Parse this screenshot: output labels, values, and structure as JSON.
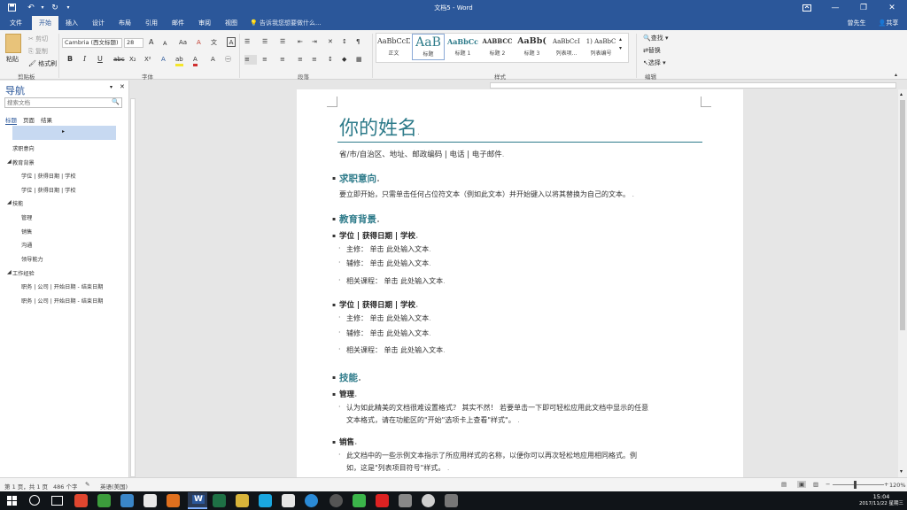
{
  "window": {
    "title": "文档5 - Word",
    "user": "曾先生",
    "share": "共享"
  },
  "tabs": [
    "文件",
    "开始",
    "插入",
    "设计",
    "布局",
    "引用",
    "邮件",
    "审阅",
    "视图"
  ],
  "tell_me": "告诉我您想要做什么...",
  "ribbon": {
    "clipboard": {
      "paste": "粘贴",
      "cut": "剪切",
      "copy": "复制",
      "format_painter": "格式刷",
      "label": "剪贴板"
    },
    "font": {
      "name": "Cambria (西文标题)",
      "size": "28",
      "label": "字体",
      "bold": "B",
      "italic": "I",
      "underline": "U",
      "strike": "abc",
      "sub": "X₂",
      "sup": "X²",
      "grow": "A",
      "shrink": "A",
      "case": "Aa",
      "font_color": "A",
      "highlight": "ab",
      "clear": "A"
    },
    "paragraph": {
      "label": "段落"
    },
    "styles": {
      "label": "样式",
      "items": [
        {
          "preview": "AaBbCcDc",
          "name": "正文"
        },
        {
          "preview": "AaB",
          "name": "标题"
        },
        {
          "preview": "AaBbCc",
          "name": "标题 1"
        },
        {
          "preview": "AABBCC",
          "name": "标题 2"
        },
        {
          "preview": "AaBb(",
          "name": "标题 3"
        },
        {
          "preview": "AaBbCcI",
          "name": "列表项..."
        },
        {
          "preview": "1) AaBbC",
          "name": "列表编号"
        }
      ]
    },
    "editing": {
      "find": "查找",
      "replace": "替换",
      "select": "选择",
      "label": "编辑"
    }
  },
  "nav": {
    "title": "导航",
    "search_placeholder": "搜索文档",
    "tabs": [
      "标题",
      "页面",
      "结果"
    ],
    "items": [
      {
        "text": "求职意向",
        "level": 1
      },
      {
        "text": "教育背景",
        "level": 1
      },
      {
        "text": "学位 | 获得日期 | 学校",
        "level": 2
      },
      {
        "text": "学位 | 获得日期 | 学校",
        "level": 2
      },
      {
        "text": "技能",
        "level": 1
      },
      {
        "text": "管理",
        "level": 2
      },
      {
        "text": "销售",
        "level": 2
      },
      {
        "text": "沟通",
        "level": 2
      },
      {
        "text": "领导能力",
        "level": 2
      },
      {
        "text": "工作经验",
        "level": 1
      },
      {
        "text": "职务 | 公司 | 开始日期 - 结束日期",
        "level": 2
      },
      {
        "text": "职务 | 公司 | 开始日期 - 结束日期",
        "level": 2
      }
    ]
  },
  "doc": {
    "name": "你的姓名",
    "contact": "省/市/自治区、地址、邮政编码 | 电话 | 电子邮件",
    "s1_title": "求职意向",
    "s1_body": "要立即开始，只需单击任何占位符文本（例如此文本）并开始键入以将其替换为自己的文本。",
    "s2_title": "教育背景",
    "deg1": "学位 | 获得日期 | 学校",
    "major1": "主修： 单击 此处输入文本",
    "minor1": "辅修： 单击 此处输入文本",
    "course1": "相关课程： 单击 此处输入文本",
    "deg2": "学位 | 获得日期 | 学校",
    "major2": "主修： 单击 此处输入文本",
    "minor2": "辅修： 单击 此处输入文本",
    "course2": "相关课程： 单击 此处输入文本",
    "s3_title": "技能",
    "mgmt": "管理",
    "mgmt_body1": "认为如此精美的文档很难设置格式？ 其实不然！ 若要单击一下即可轻松应用此文档中显示的任意",
    "mgmt_body2": "文本格式，请在功能区的\"开始\"选项卡上查看\"样式\"。",
    "sales": "销售",
    "sales_body1": "此文档中的一些示例文本指示了所应用样式的名称，以便你可以再次轻松地应用相同格式。例",
    "sales_body2": "如，这是\"列表项目符号\"样式。"
  },
  "status": {
    "page": "第 1 页，共 1 页",
    "words": "486 个字",
    "lang": "英语(美国)",
    "zoom": "120%"
  },
  "taskbar": {
    "time": "15:04",
    "date": "2017/11/22 星期三"
  }
}
